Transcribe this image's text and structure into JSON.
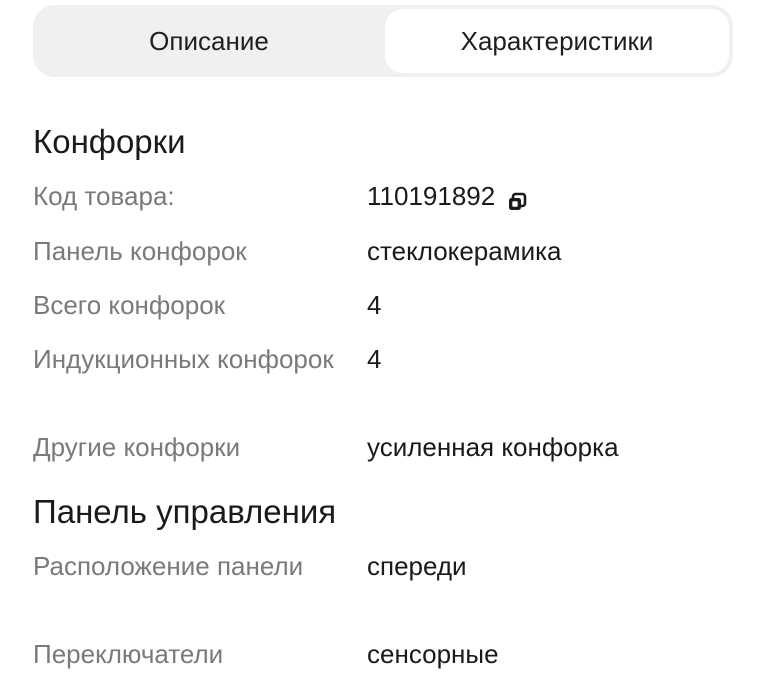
{
  "tabs": [
    {
      "label": "Описание",
      "active": false
    },
    {
      "label": "Характеристики",
      "active": true
    }
  ],
  "sections": {
    "burners": {
      "title": "Конфорки",
      "rows": [
        {
          "key": "Код товара:",
          "value": "110191892"
        },
        {
          "key": "Панель конфорок",
          "value": "стеклокерамика"
        },
        {
          "key": "Всего конфорок",
          "value": "4"
        },
        {
          "key": "Индукционных конфорок",
          "value": "4"
        },
        {
          "key": "Другие конфорки",
          "value": "усиленная конфорка"
        }
      ]
    },
    "control_panel": {
      "title": "Панель управления",
      "rows": [
        {
          "key": "Расположение панели",
          "value": "спереди"
        },
        {
          "key": "Переключатели",
          "value": "сенсорные"
        }
      ]
    }
  },
  "icons": {
    "copy": "copy-icon"
  }
}
